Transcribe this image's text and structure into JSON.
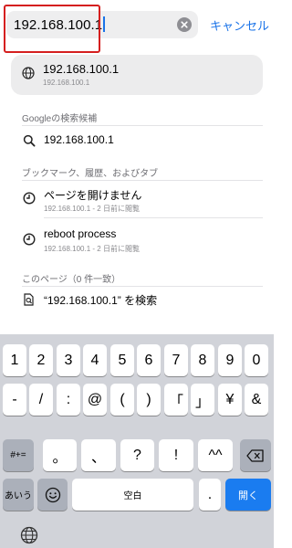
{
  "search": {
    "value": "192.168.100.1",
    "cancel_label": "キャンセル"
  },
  "top_hit": {
    "title": "192.168.100.1",
    "subtitle": "192.168.100.1",
    "icon": "globe-icon"
  },
  "google_section": {
    "header": "Googleの検索候補",
    "suggestion": "192.168.100.1",
    "icon": "search-icon"
  },
  "history_section": {
    "header": "ブックマーク、履歴、およびタブ",
    "items": [
      {
        "title": "ページを開けません",
        "subtitle": "192.168.100.1 - 2 日前に閲覧",
        "icon": "clock-icon"
      },
      {
        "title": "reboot process",
        "subtitle": "192.168.100.1 - 2 日前に閲覧",
        "icon": "clock-icon"
      }
    ]
  },
  "page_section": {
    "header": "このページ（0 件一致）",
    "find_label": "“192.168.100.1” を検索",
    "icon": "find-in-page-icon"
  },
  "keyboard": {
    "row1": [
      "1",
      "2",
      "3",
      "4",
      "5",
      "6",
      "7",
      "8",
      "9",
      "0"
    ],
    "row2": [
      "-",
      "/",
      ":",
      "@",
      "(",
      ")",
      "「",
      "」",
      "¥",
      "&"
    ],
    "row3_mode": "#+=",
    "row3": [
      "。",
      "、",
      "?",
      "!",
      "^^"
    ],
    "row3_delete_icon": "backspace-icon",
    "row4_mode": "あいう",
    "row4_emoji_icon": "emoji-icon",
    "space": "空白",
    "period": ".",
    "go": "開く",
    "globe_icon": "globe-icon"
  },
  "colors": {
    "accent": "#1a73e8",
    "highlight_box": "#d51f1f",
    "go_key": "#1a7cf0",
    "keyboard_bg": "#d1d3d9"
  }
}
